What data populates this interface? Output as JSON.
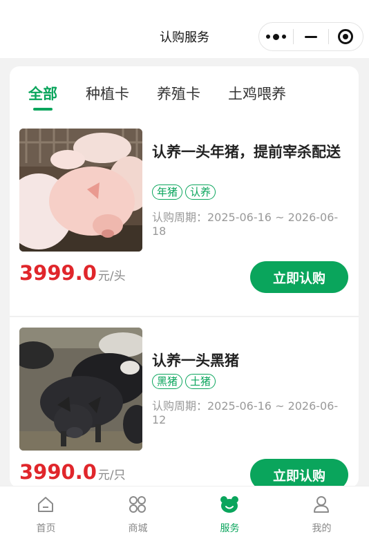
{
  "nav": {
    "title": "认购服务"
  },
  "tabs": [
    {
      "label": "全部",
      "active": true
    },
    {
      "label": "种植卡",
      "active": false
    },
    {
      "label": "养殖卡",
      "active": false
    },
    {
      "label": "土鸡喂养",
      "active": false
    }
  ],
  "products": [
    {
      "title": "认养一头年猪，提前宰杀配送",
      "tags": [
        "年猪",
        "认养"
      ],
      "period": "认购周期：2025-06-16 ~ 2026-06-18",
      "price": "3999.0",
      "unit": "元/头",
      "button": "立即认购"
    },
    {
      "title": "认养一头黑猪",
      "tags": [
        "黑猪",
        "土猪"
      ],
      "period": "认购周期：2025-06-16 ~ 2026-06-12",
      "price": "3990.0",
      "unit": "元/只",
      "button": "立即认购"
    }
  ],
  "tabbar": [
    {
      "label": "首页",
      "icon": "home-icon"
    },
    {
      "label": "商城",
      "icon": "mall-grid-icon"
    },
    {
      "label": "服务",
      "icon": "service-bear-icon",
      "active": true
    },
    {
      "label": "我的",
      "icon": "user-icon"
    }
  ],
  "colors": {
    "accent": "#0aa55c",
    "price": "#e0262b"
  }
}
